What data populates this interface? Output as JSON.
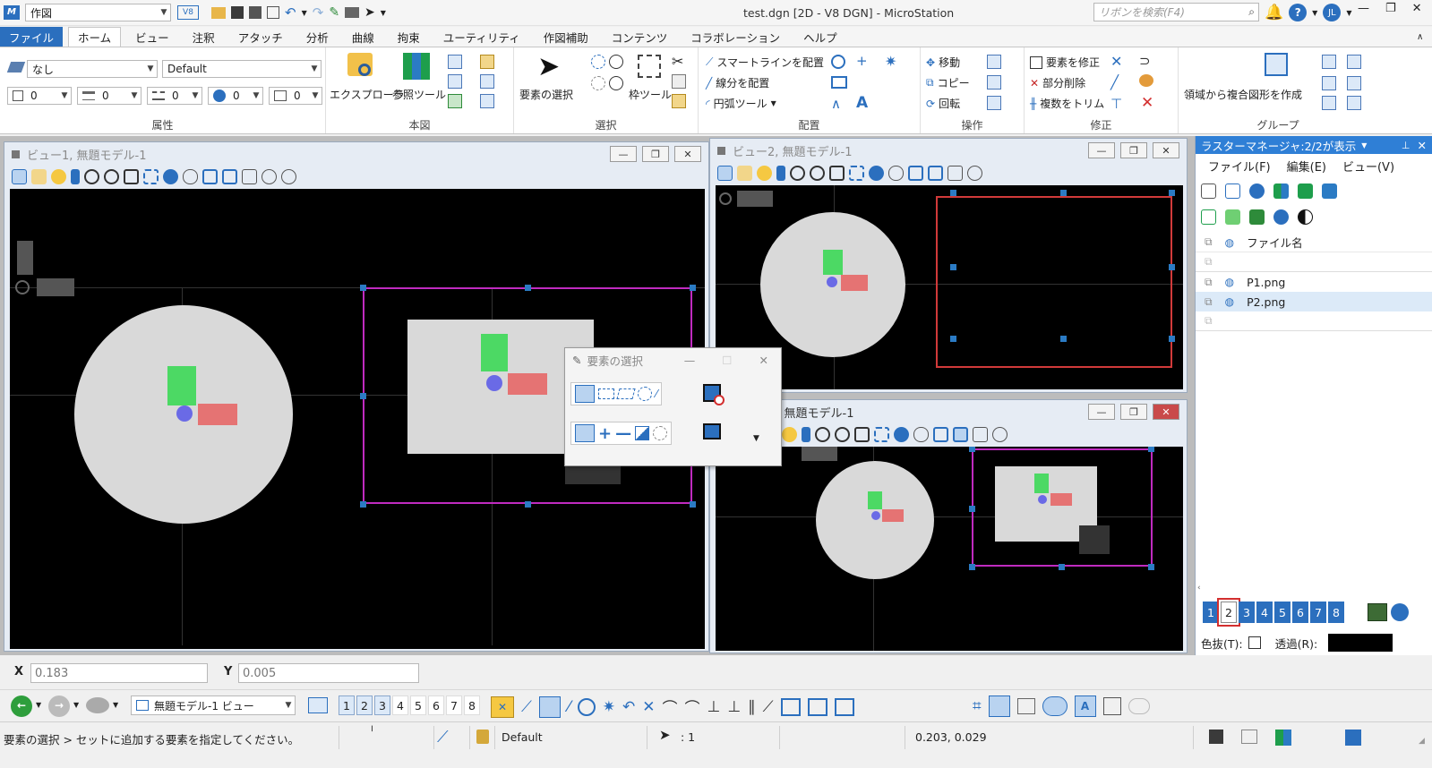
{
  "titlebar": {
    "workset": "作図",
    "title": "test.dgn [2D - V8 DGN] - MicroStation",
    "search_placeholder": "リボンを検索(F4)",
    "user_initials": "JL"
  },
  "tabs": [
    "ファイル",
    "ホーム",
    "ビュー",
    "注釈",
    "アタッチ",
    "分析",
    "曲線",
    "拘束",
    "ユーティリティ",
    "作図補助",
    "コンテンツ",
    "コラボレーション",
    "ヘルプ"
  ],
  "ribbon": {
    "attr": {
      "level": "なし",
      "style": "Default",
      "color": "0",
      "weight": "0",
      "linestyle": "0",
      "transparency": "0",
      "priority": "0",
      "label": "属性"
    },
    "honzu": {
      "explorer": "エクスプローラ",
      "reftool": "参照ツール",
      "label": "本図"
    },
    "select": {
      "element_select": "要素の選択",
      "fence_tool": "枠ツール",
      "label": "選択"
    },
    "placement": {
      "smartline": "スマートラインを配置",
      "line": "線分を配置",
      "arc": "円弧ツール",
      "label": "配置"
    },
    "ops": {
      "move": "移動",
      "copy": "コピー",
      "rotate": "回転",
      "label": "操作"
    },
    "modify": {
      "modify": "要素を修正",
      "partial_delete": "部分削除",
      "trim_multiple": "複数をトリム",
      "label": "修正"
    },
    "group": {
      "region": "領域から複合図形を作成",
      "label": "グループ"
    }
  },
  "views": {
    "v1": "ビュー1, 無題モデル-1",
    "v2": "ビュー2, 無題モデル-1",
    "v3": "3, 無題モデル-1"
  },
  "raster": {
    "title": "ラスターマネージャ:2/2が表示",
    "menu": [
      "ファイル(F)",
      "編集(E)",
      "ビュー(V)"
    ],
    "col_filename": "ファイル名",
    "files": [
      "P1.png",
      "P2.png"
    ],
    "view_numbers": [
      "1",
      "2",
      "3",
      "4",
      "5",
      "6",
      "7",
      "8"
    ],
    "selected_view": "2",
    "transparent_color_label": "色抜(T):",
    "transparency_label": "透過(R):"
  },
  "dialog": {
    "title": "要素の選択"
  },
  "coords": {
    "x_label": "X",
    "x_value": "0.183",
    "y_label": "Y",
    "y_value": "0.005"
  },
  "bottom": {
    "model_view": "無題モデル-1 ビュー",
    "view_numbers": [
      "1",
      "2",
      "3",
      "4",
      "5",
      "6",
      "7",
      "8"
    ]
  },
  "status": {
    "prompt": "要素の選択 > セットに追加する要素を指定してください。",
    "level": "Default",
    "selection_count": ": 1",
    "cursor_coords": "0.203, 0.029"
  }
}
